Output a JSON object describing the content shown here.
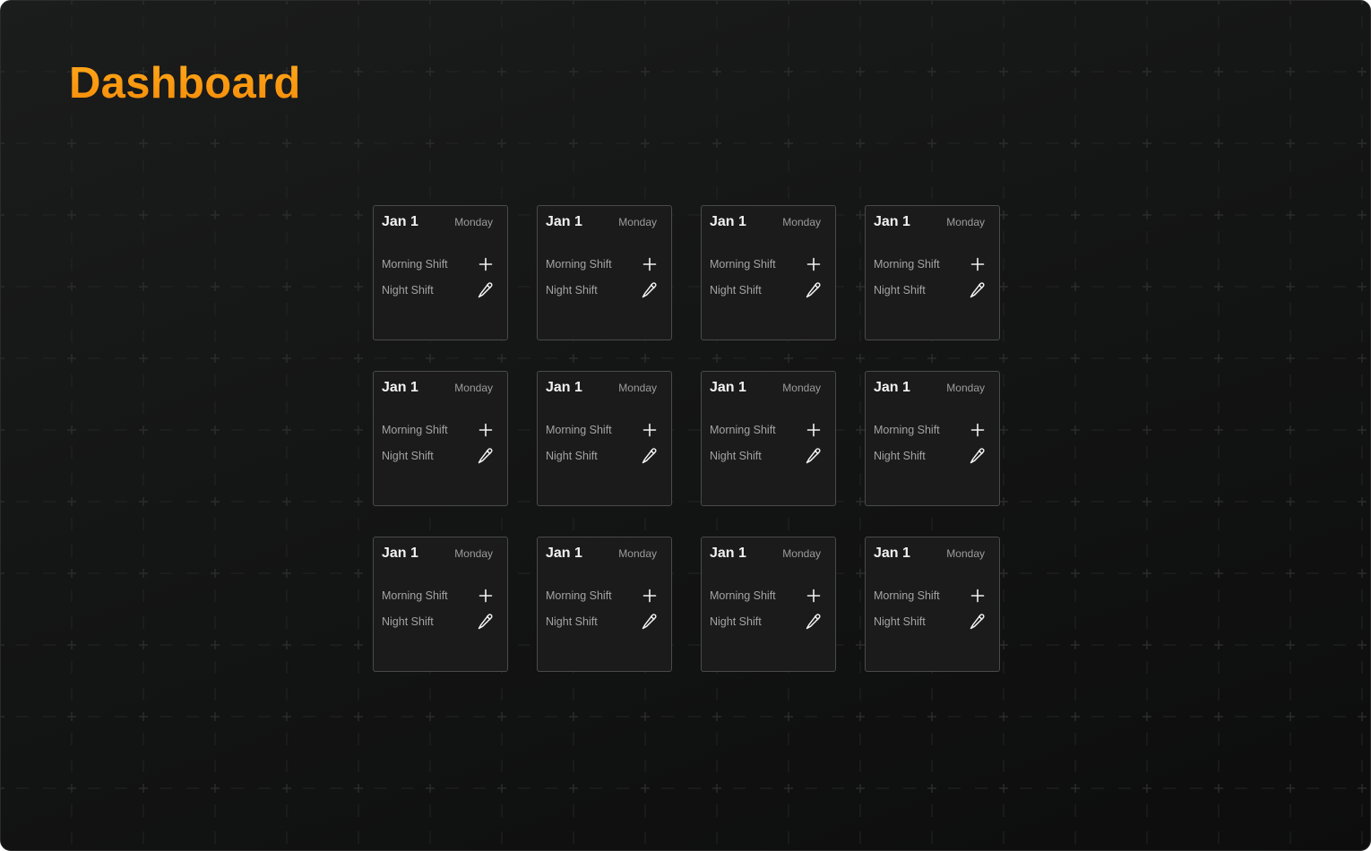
{
  "page": {
    "title": "Dashboard",
    "title_color": "#ff9f12"
  },
  "cards": [
    {
      "date": "Jan 1",
      "day": "Monday",
      "morning_label": "Morning Shift",
      "night_label": "Night Shift",
      "morning_icon": "plus-icon",
      "night_icon": "pencil-icon"
    },
    {
      "date": "Jan 1",
      "day": "Monday",
      "morning_label": "Morning Shift",
      "night_label": "Night Shift",
      "morning_icon": "plus-icon",
      "night_icon": "pencil-icon"
    },
    {
      "date": "Jan 1",
      "day": "Monday",
      "morning_label": "Morning Shift",
      "night_label": "Night Shift",
      "morning_icon": "plus-icon",
      "night_icon": "pencil-icon"
    },
    {
      "date": "Jan 1",
      "day": "Monday",
      "morning_label": "Morning Shift",
      "night_label": "Night Shift",
      "morning_icon": "plus-icon",
      "night_icon": "pencil-icon"
    },
    {
      "date": "Jan 1",
      "day": "Monday",
      "morning_label": "Morning Shift",
      "night_label": "Night Shift",
      "morning_icon": "plus-icon",
      "night_icon": "pencil-icon"
    },
    {
      "date": "Jan 1",
      "day": "Monday",
      "morning_label": "Morning Shift",
      "night_label": "Night Shift",
      "morning_icon": "plus-icon",
      "night_icon": "pencil-icon"
    },
    {
      "date": "Jan 1",
      "day": "Monday",
      "morning_label": "Morning Shift",
      "night_label": "Night Shift",
      "morning_icon": "plus-icon",
      "night_icon": "pencil-icon"
    },
    {
      "date": "Jan 1",
      "day": "Monday",
      "morning_label": "Morning Shift",
      "night_label": "Night Shift",
      "morning_icon": "plus-icon",
      "night_icon": "pencil-icon"
    },
    {
      "date": "Jan 1",
      "day": "Monday",
      "morning_label": "Morning Shift",
      "night_label": "Night Shift",
      "morning_icon": "plus-icon",
      "night_icon": "pencil-icon"
    },
    {
      "date": "Jan 1",
      "day": "Monday",
      "morning_label": "Morning Shift",
      "night_label": "Night Shift",
      "morning_icon": "plus-icon",
      "night_icon": "pencil-icon"
    },
    {
      "date": "Jan 1",
      "day": "Monday",
      "morning_label": "Morning Shift",
      "night_label": "Night Shift",
      "morning_icon": "plus-icon",
      "night_icon": "pencil-icon"
    },
    {
      "date": "Jan 1",
      "day": "Monday",
      "morning_label": "Morning Shift",
      "night_label": "Night Shift",
      "morning_icon": "plus-icon",
      "night_icon": "pencil-icon"
    }
  ]
}
